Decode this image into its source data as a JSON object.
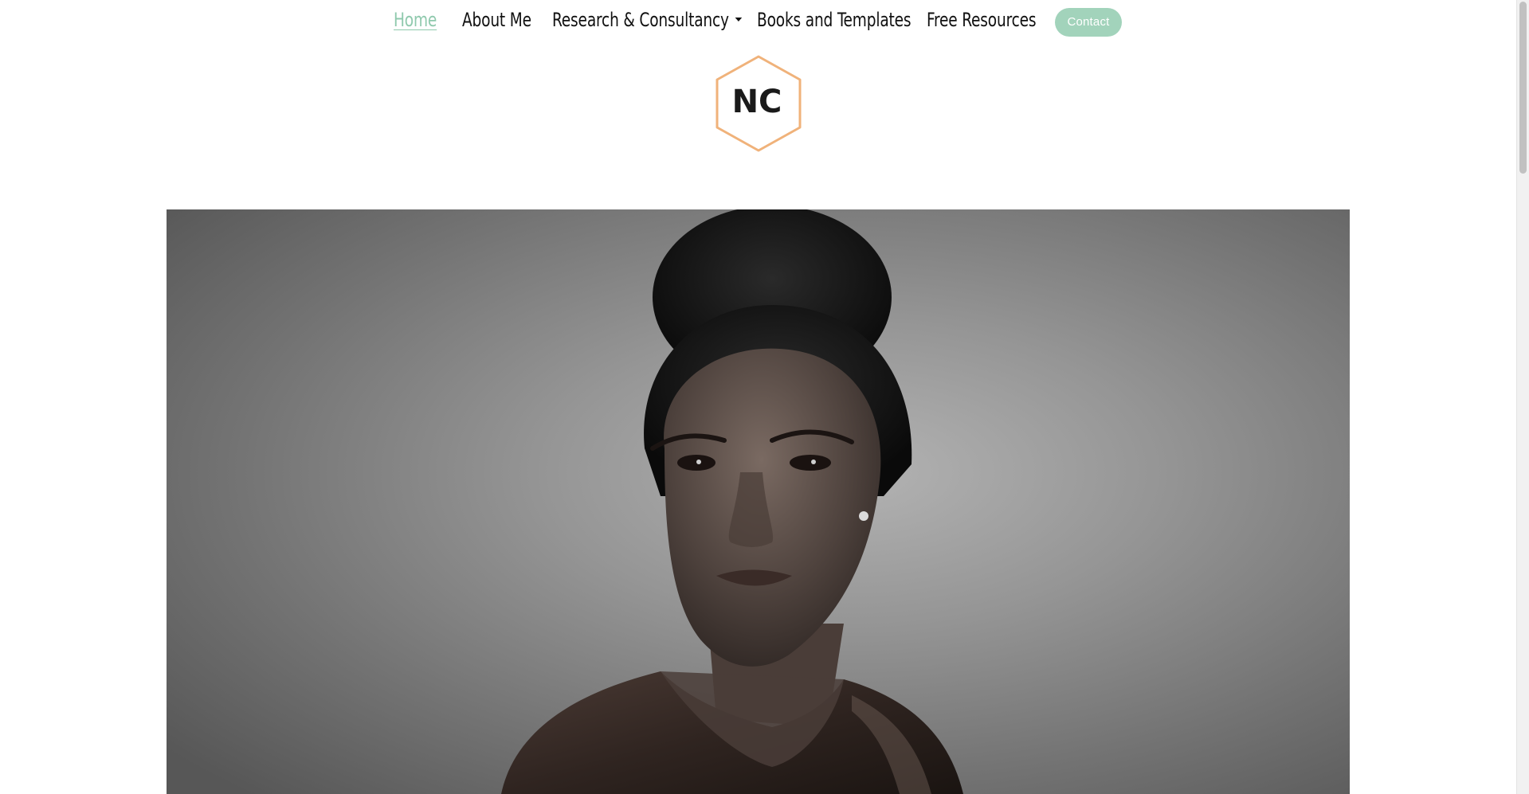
{
  "nav": {
    "items": [
      {
        "label": "Home",
        "active": true
      },
      {
        "label": "About Me"
      },
      {
        "label": "Research & Consultancy",
        "has_dropdown": true
      },
      {
        "label": "Books and Templates"
      },
      {
        "label": "Free Resources"
      }
    ],
    "contact_label": "Contact"
  },
  "logo": {
    "text": "NC"
  },
  "colors": {
    "accent": "#8fc9ad",
    "button": "#a2d3bb",
    "logo_border": "#f0b27a",
    "text": "#111111"
  },
  "hero": {
    "icon": "portrait-photo"
  }
}
